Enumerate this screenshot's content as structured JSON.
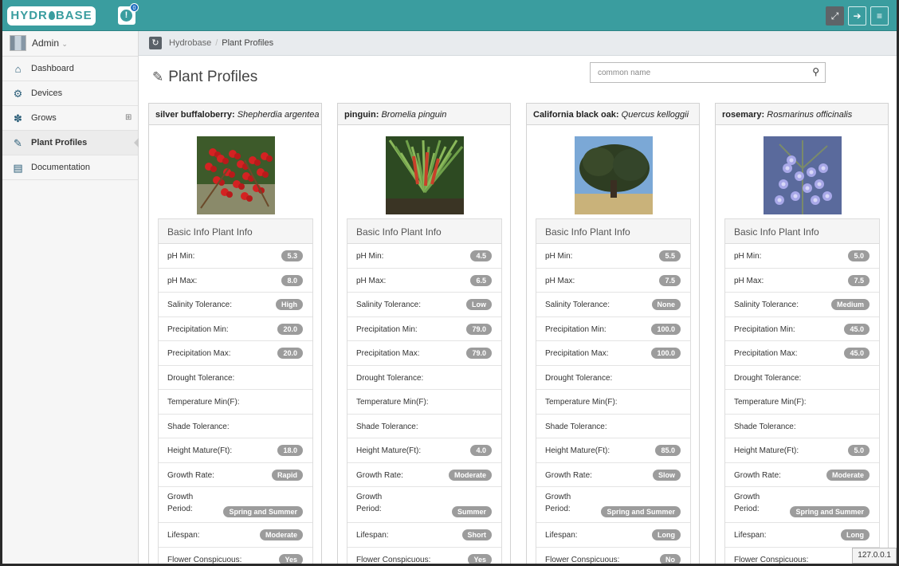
{
  "app": {
    "logo_text": "HYDR BASE",
    "notification_count": "0"
  },
  "user": {
    "name": "Admin"
  },
  "sidebar": {
    "items": [
      {
        "label": "Dashboard",
        "icon": "home-icon"
      },
      {
        "label": "Devices",
        "icon": "gears-icon"
      },
      {
        "label": "Grows",
        "icon": "plant-icon",
        "expandable": true
      },
      {
        "label": "Plant Profiles",
        "icon": "edit-icon",
        "active": true
      },
      {
        "label": "Documentation",
        "icon": "document-icon"
      }
    ]
  },
  "breadcrumb": {
    "root": "Hydrobase",
    "current": "Plant Profiles"
  },
  "page": {
    "title": "Plant Profiles"
  },
  "search": {
    "placeholder": "common name"
  },
  "info_title": "Basic Info Plant Info",
  "field_labels": {
    "ph_min": "pH Min:",
    "ph_max": "pH Max:",
    "salinity": "Salinity Tolerance:",
    "precip_min": "Precipitation Min:",
    "precip_max": "Precipitation Max:",
    "drought": "Drought Tolerance:",
    "temp_min": "Temperature Min(F):",
    "shade": "Shade Tolerance:",
    "height": "Height Mature(Ft):",
    "growth_rate": "Growth Rate:",
    "growth_period_1": "Growth",
    "growth_period_2": "Period:",
    "lifespan": "Lifespan:",
    "flower": "Flower Conspicuous:"
  },
  "plants": [
    {
      "common": "silver buffaloberry:",
      "scientific": "Shepherdia argentea",
      "ph_min": "5.3",
      "ph_max": "8.0",
      "salinity": "High",
      "precip_min": "20.0",
      "precip_max": "20.0",
      "drought": "",
      "temp_min": "",
      "shade": "",
      "height": "18.0",
      "growth_rate": "Rapid",
      "growth_period": "Spring and Summer",
      "lifespan": "Moderate",
      "flower": "Yes"
    },
    {
      "common": "pinguin:",
      "scientific": "Bromelia pinguin",
      "ph_min": "4.5",
      "ph_max": "6.5",
      "salinity": "Low",
      "precip_min": "79.0",
      "precip_max": "79.0",
      "drought": "",
      "temp_min": "",
      "shade": "",
      "height": "4.0",
      "growth_rate": "Moderate",
      "growth_period": "Summer",
      "lifespan": "Short",
      "flower": "Yes"
    },
    {
      "common": "California black oak:",
      "scientific": "Quercus kelloggii",
      "ph_min": "5.5",
      "ph_max": "7.5",
      "salinity": "None",
      "precip_min": "100.0",
      "precip_max": "100.0",
      "drought": "",
      "temp_min": "",
      "shade": "",
      "height": "85.0",
      "growth_rate": "Slow",
      "growth_period": "Spring and Summer",
      "lifespan": "Long",
      "flower": "No"
    },
    {
      "common": "rosemary:",
      "scientific": "Rosmarinus officinalis",
      "ph_min": "5.0",
      "ph_max": "7.5",
      "salinity": "Medium",
      "precip_min": "45.0",
      "precip_max": "45.0",
      "drought": "",
      "temp_min": "",
      "shade": "",
      "height": "5.0",
      "growth_rate": "Moderate",
      "growth_period": "Spring and Summer",
      "lifespan": "Long",
      "flower": ""
    }
  ],
  "footer": {
    "ip": "127.0.0.1"
  },
  "colors": {
    "accent": "#3a9d9f",
    "badge": "#9c9c9c"
  }
}
